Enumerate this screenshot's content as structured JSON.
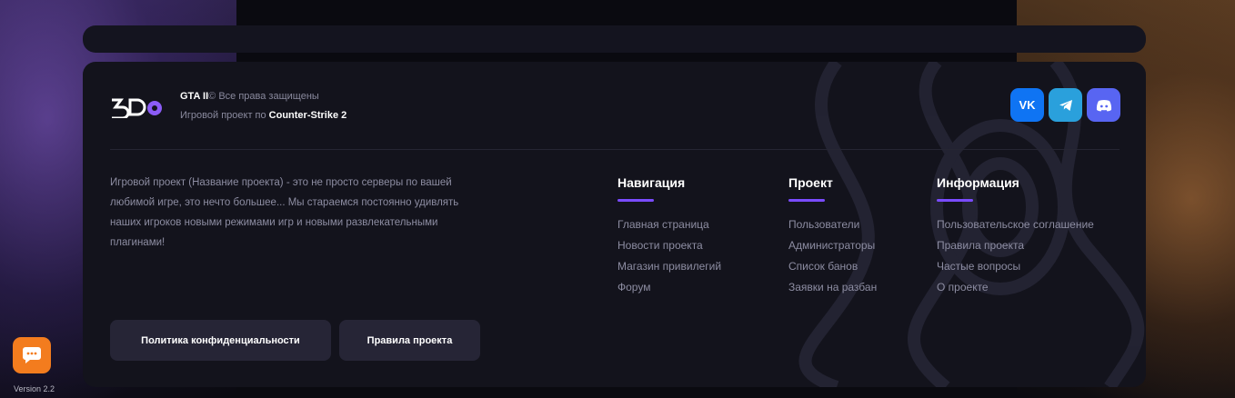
{
  "brand": {
    "name": "GTA II",
    "copyright": "© Все права защищены",
    "subtitle_prefix": "Игровой проект по ",
    "game": "Counter-Strike 2"
  },
  "social": {
    "vk_label": "VK",
    "telegram_icon": "telegram-icon",
    "discord_icon": "discord-icon"
  },
  "about": "Игровой проект (Название проекта) - это не просто серверы по вашей любимой игре, это нечто большее... Мы стараемся постоянно удивлять наших игроков новыми режимами игр и новыми развлекательными плагинами!",
  "columns": {
    "navigation": {
      "title": "Навигация",
      "links": [
        "Главная страница",
        "Новости проекта",
        "Магазин привилегий",
        "Форум"
      ]
    },
    "project": {
      "title": "Проект",
      "links": [
        "Пользователи",
        "Администраторы",
        "Список банов",
        "Заявки на разбан"
      ]
    },
    "information": {
      "title": "Информация",
      "links": [
        "Пользовательское соглашение",
        "Правила проекта",
        "Частые вопросы",
        "О проекте"
      ]
    }
  },
  "buttons": {
    "privacy": "Политика конфиденциальности",
    "rules": "Правила проекта"
  },
  "version": "Version 2.2",
  "colors": {
    "accent": "#7a4bff",
    "vk": "#0f74f3",
    "telegram": "#2aa0dc",
    "discord": "#5865f2",
    "chat": "#f37c1e"
  }
}
